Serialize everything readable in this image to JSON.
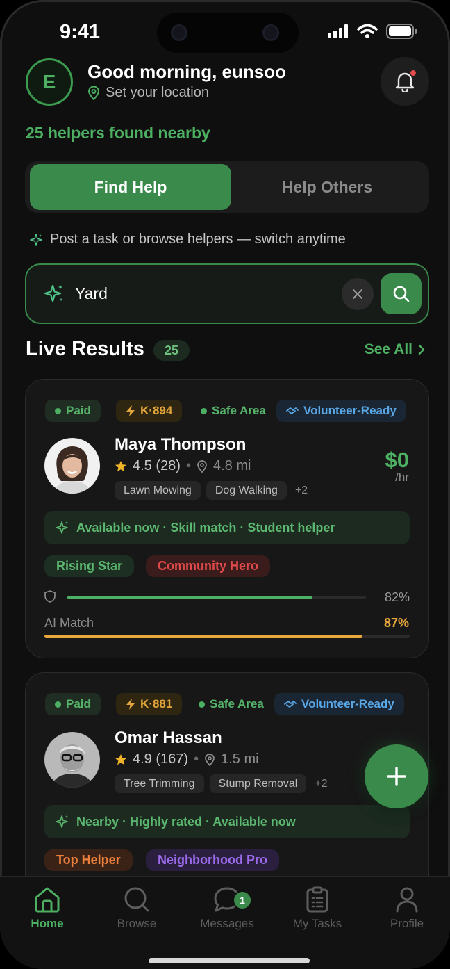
{
  "status": {
    "time": "9:41"
  },
  "header": {
    "avatar_initial": "E",
    "greeting": "Good morning, eunsoo",
    "location": "Set your location",
    "helpers_found": "25 helpers found nearby"
  },
  "mode_toggle": {
    "active": "Find Help",
    "inactive": "Help Others"
  },
  "hint": "Post a task or browse helpers — switch anytime",
  "search": {
    "value": "Yard"
  },
  "results": {
    "title": "Live Results",
    "count": "25",
    "see_all": "See All"
  },
  "cards": [
    {
      "paid": "Paid",
      "k_score": "K·894",
      "safe_area": "Safe Area",
      "volunteer": "Volunteer-Ready",
      "name": "Maya Thompson",
      "rating": "4.5 (28)",
      "distance": "4.8 mi",
      "skills": [
        "Lawn Mowing",
        "Dog Walking"
      ],
      "skills_more": "+2",
      "price": "$0",
      "price_unit": "/hr",
      "banner": "Available now · Skill match · Student helper",
      "badges": [
        "Rising Star",
        "Community Hero"
      ],
      "trust_pct": "82%",
      "trust_value": 0.82,
      "match_label": "AI Match",
      "match_pct": "87%",
      "match_value": 0.87
    },
    {
      "paid": "Paid",
      "k_score": "K·881",
      "safe_area": "Safe Area",
      "volunteer": "Volunteer-Ready",
      "name": "Omar Hassan",
      "rating": "4.9 (167)",
      "distance": "1.5 mi",
      "skills": [
        "Tree Trimming",
        "Stump Removal"
      ],
      "skills_more": "+2",
      "banner": "Nearby · Highly rated · Available now",
      "badges": [
        "Top Helper",
        "Neighborhood Pro"
      ]
    }
  ],
  "tabs": [
    {
      "label": "Home",
      "icon": "home-icon"
    },
    {
      "label": "Browse",
      "icon": "search-icon"
    },
    {
      "label": "Messages",
      "icon": "chat-icon",
      "badge": "1"
    },
    {
      "label": "My Tasks",
      "icon": "clipboard-icon"
    },
    {
      "label": "Profile",
      "icon": "user-icon"
    }
  ],
  "colors": {
    "accent": "#3a8a4c",
    "accent_text": "#4caf62",
    "amber": "#e8a83c",
    "blue": "#5aa7e6",
    "red": "#e04a4a",
    "purple": "#9b6bec",
    "orange": "#ec7f3c",
    "background": "#0f0f0f"
  }
}
